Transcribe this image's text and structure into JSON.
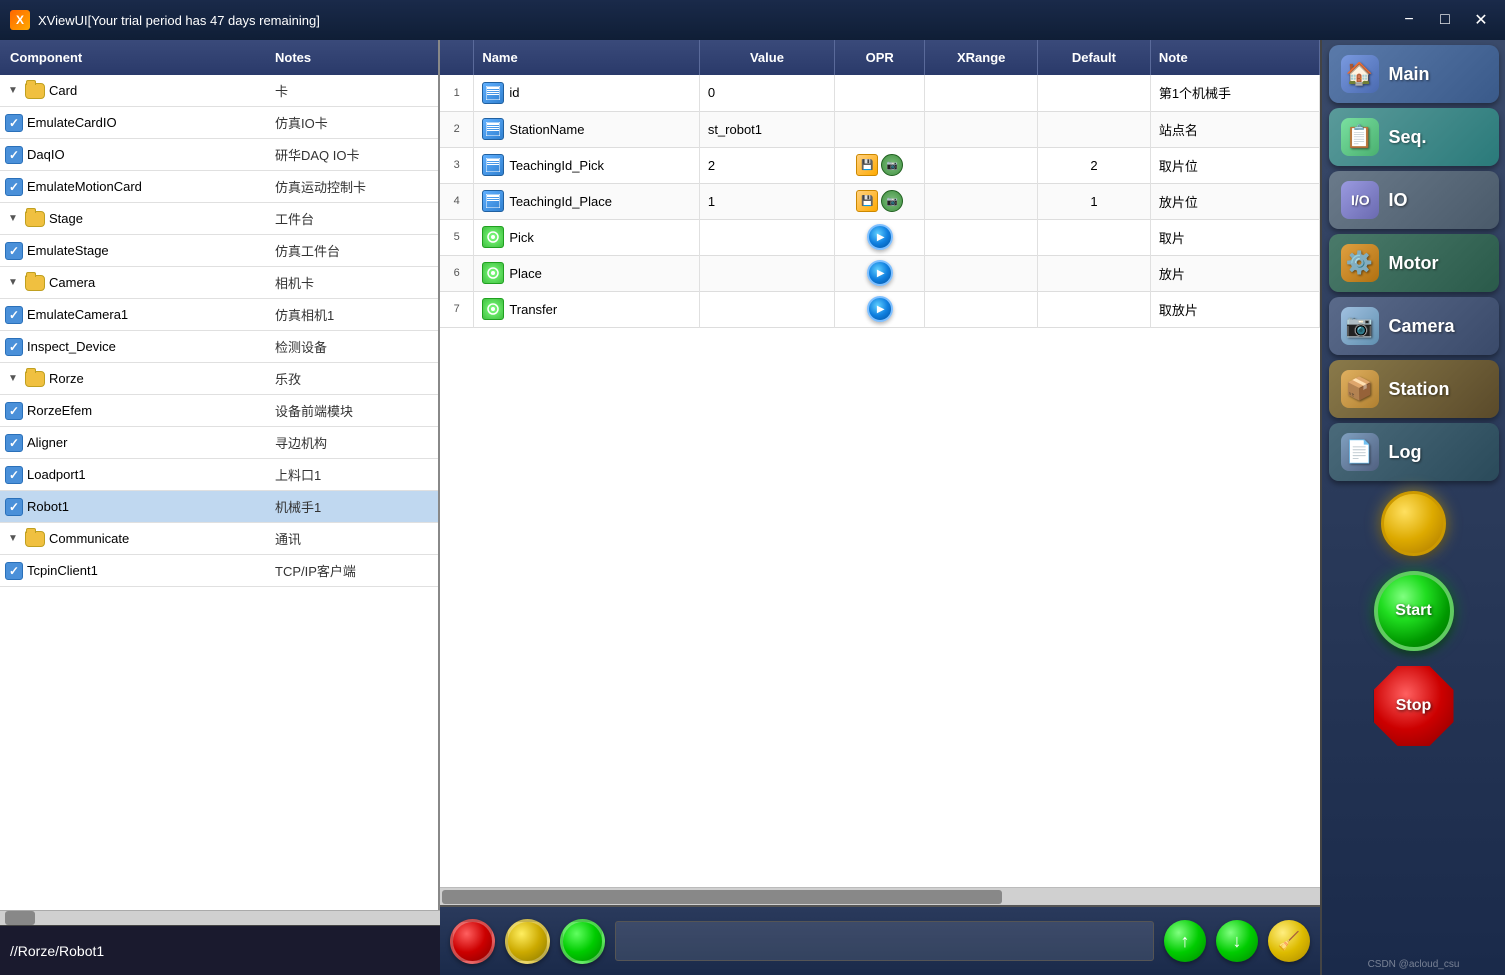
{
  "titlebar": {
    "icon_text": "X",
    "title": "XViewUI[Your trial period has 47 days remaining]",
    "minimize_label": "−",
    "maximize_label": "□",
    "close_label": "✕"
  },
  "tree": {
    "col_component": "Component",
    "col_notes": "Notes",
    "items": [
      {
        "id": "card",
        "indent": 0,
        "type": "group",
        "label": "Card",
        "notes": "卡",
        "expanded": true
      },
      {
        "id": "emulatecardio",
        "indent": 1,
        "type": "checked",
        "label": "EmulateCardIO",
        "notes": "仿真IO卡"
      },
      {
        "id": "daqio",
        "indent": 1,
        "type": "checked",
        "label": "DaqIO",
        "notes": "研华DAQ IO卡"
      },
      {
        "id": "emotioncard",
        "indent": 1,
        "type": "checked",
        "label": "EmulateMotionCard",
        "notes": "仿真运动控制卡"
      },
      {
        "id": "stage",
        "indent": 0,
        "type": "group",
        "label": "Stage",
        "notes": "工件台",
        "expanded": true
      },
      {
        "id": "emulatestage",
        "indent": 1,
        "type": "checked",
        "label": "EmulateStage",
        "notes": "仿真工件台"
      },
      {
        "id": "camera",
        "indent": 0,
        "type": "group",
        "label": "Camera",
        "notes": "相机卡",
        "expanded": true
      },
      {
        "id": "emulatecamera1",
        "indent": 1,
        "type": "checked",
        "label": "EmulateCamera1",
        "notes": "仿真相机1"
      },
      {
        "id": "inspect_device",
        "indent": 1,
        "type": "checked",
        "label": "Inspect_Device",
        "notes": "检测设备"
      },
      {
        "id": "rorze",
        "indent": 0,
        "type": "group",
        "label": "Rorze",
        "notes": "乐孜",
        "expanded": true
      },
      {
        "id": "rorzeefem",
        "indent": 1,
        "type": "checked",
        "label": "RorzeEfem",
        "notes": "设备前端模块"
      },
      {
        "id": "aligner",
        "indent": 1,
        "type": "checked",
        "label": "Aligner",
        "notes": "寻边机构"
      },
      {
        "id": "loadport1",
        "indent": 1,
        "type": "checked",
        "label": "Loadport1",
        "notes": "上料口1"
      },
      {
        "id": "robot1",
        "indent": 1,
        "type": "checked",
        "label": "Robot1",
        "notes": "机械手1",
        "selected": true
      },
      {
        "id": "communicate",
        "indent": 0,
        "type": "group",
        "label": "Communicate",
        "notes": "通讯",
        "expanded": true
      },
      {
        "id": "tcpinclient1",
        "indent": 1,
        "type": "checked",
        "label": "TcpinClient1",
        "notes": "TCP/IP客户端"
      }
    ]
  },
  "path": "//Rorze/Robot1",
  "table": {
    "columns": [
      "",
      "Name",
      "Value",
      "OPR",
      "XRange",
      "Default",
      "Note"
    ],
    "rows": [
      {
        "num": "1",
        "icon": "table",
        "name": "id",
        "value": "0",
        "opr": "",
        "xrange": "",
        "default": "",
        "note": "第1个机械手"
      },
      {
        "num": "2",
        "icon": "table",
        "name": "StationName",
        "value": "st_robot1",
        "opr": "",
        "xrange": "",
        "default": "",
        "note": "站点名"
      },
      {
        "num": "3",
        "icon": "table",
        "name": "TeachingId_Pick",
        "value": "2",
        "opr": "save+cam",
        "xrange": "",
        "default": "2",
        "note": "取片位"
      },
      {
        "num": "4",
        "icon": "table",
        "name": "TeachingId_Place",
        "value": "1",
        "opr": "save+cam",
        "xrange": "",
        "default": "1",
        "note": "放片位"
      },
      {
        "num": "5",
        "icon": "gear",
        "name": "Pick",
        "value": "",
        "opr": "play",
        "xrange": "",
        "default": "",
        "note": "取片"
      },
      {
        "num": "6",
        "icon": "gear",
        "name": "Place",
        "value": "",
        "opr": "play",
        "xrange": "",
        "default": "",
        "note": "放片"
      },
      {
        "num": "7",
        "icon": "gear",
        "name": "Transfer",
        "value": "",
        "opr": "play",
        "xrange": "",
        "default": "",
        "note": "取放片"
      }
    ]
  },
  "nav_buttons": [
    {
      "id": "main",
      "label": "Main",
      "icon": "🏠"
    },
    {
      "id": "seq",
      "label": "Seq.",
      "icon": "📋"
    },
    {
      "id": "io",
      "label": "IO",
      "icon": "⚡"
    },
    {
      "id": "motor",
      "label": "Motor",
      "icon": "⚙️"
    },
    {
      "id": "camera",
      "label": "Camera",
      "icon": "📷"
    },
    {
      "id": "station",
      "label": "Station",
      "icon": "📦"
    },
    {
      "id": "log",
      "label": "Log",
      "icon": "📄"
    }
  ],
  "bottom_buttons": {
    "circle_red": "red",
    "circle_yellow": "yellow",
    "circle_green": "green",
    "arrow_up": "↑",
    "arrow_down": "↓",
    "broom": "🧹",
    "start_label": "Start",
    "stop_label": "Stop"
  },
  "watermark": "CSDN @acloud_csu"
}
